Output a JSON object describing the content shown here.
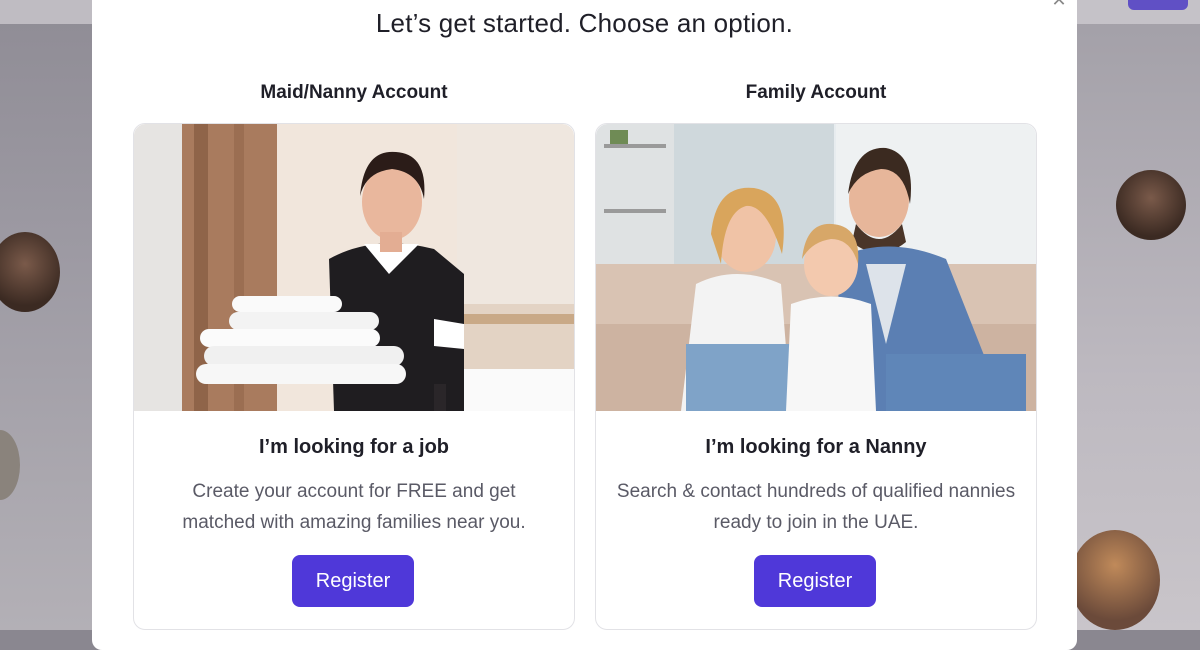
{
  "modal": {
    "title": "Let’s get started. Choose an option.",
    "close_icon": "close-icon"
  },
  "options": [
    {
      "heading": "Maid/Nanny Account",
      "image": "maid-holding-towels-photo",
      "card_title": "I’m looking for a job",
      "description": "Create your account for FREE and get matched with amazing families near you.",
      "button_label": "Register"
    },
    {
      "heading": "Family Account",
      "image": "family-on-sofa-photo",
      "card_title": "I’m looking for a Nanny",
      "description": "Search & contact hundreds of qualified nannies ready to join in the UAE.",
      "button_label": "Register"
    }
  ],
  "colors": {
    "accent": "#4f38d9",
    "overlay": "#9b98a0",
    "text_dark": "#1f1f28",
    "text_muted": "#5a5a66"
  }
}
